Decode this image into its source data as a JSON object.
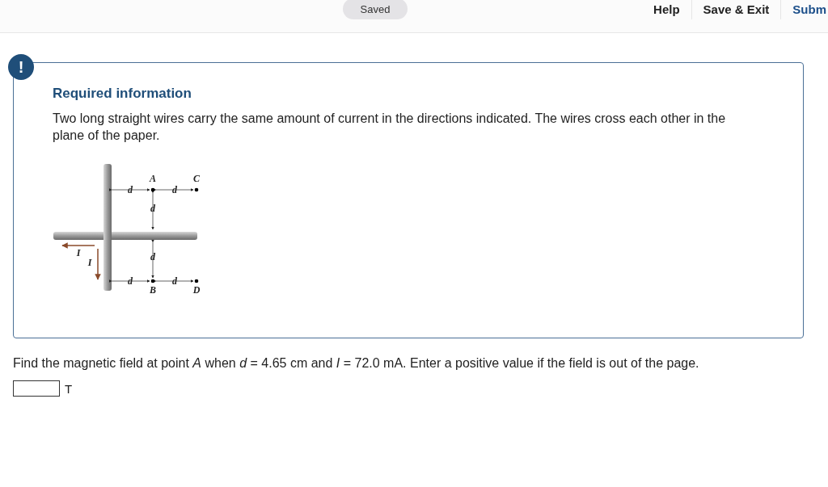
{
  "top_bar": {
    "status": "Saved",
    "nav": [
      {
        "label": "Help",
        "kind": "plain"
      },
      {
        "label": "Save & Exit",
        "kind": "plain"
      },
      {
        "label": "Subm",
        "kind": "primary"
      }
    ]
  },
  "alert_icon": "!",
  "info_card": {
    "heading": "Required information",
    "text": "Two long straight wires carry the same amount of current in the directions indicated. The wires cross each other in the plane of the paper.",
    "figure": {
      "point_labels": [
        "A",
        "C",
        "B",
        "D"
      ],
      "distance_labels": [
        "d",
        "d",
        "d",
        "d",
        "d",
        "d"
      ],
      "current_labels": [
        "I",
        "I"
      ]
    }
  },
  "question": "Find the magnetic field at point *A* when *d* = 4.65 cm and *I* = 72.0 mA. Enter a positive value if the field is out of the page.",
  "answer": {
    "unit": "T"
  }
}
